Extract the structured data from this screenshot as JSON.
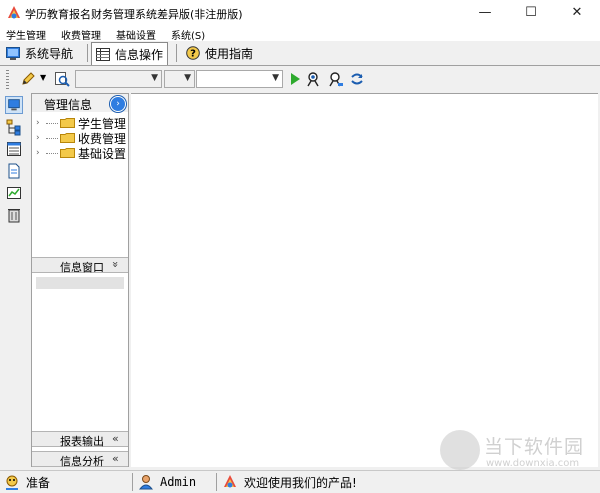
{
  "window": {
    "title": "学历教育报名财务管理系统差异版(非注册版)",
    "controls": {
      "minimize": "—",
      "maximize": "☐",
      "close": "✕"
    }
  },
  "menubar": {
    "items": [
      {
        "label": "学生管理"
      },
      {
        "label": "收费管理"
      },
      {
        "label": "基础设置"
      },
      {
        "label": "系统(S)"
      }
    ]
  },
  "tabs": [
    {
      "label": "系统导航",
      "icon": "monitor-icon"
    },
    {
      "label": "信息操作",
      "icon": "table-icon",
      "active": true
    },
    {
      "label": "使用指南",
      "icon": "help-icon"
    }
  ],
  "toolbar": {
    "combo1": "",
    "combo2": "",
    "combo3": "",
    "icons": [
      "pencil-icon",
      "dropdown-icon",
      "preview-icon",
      "play-icon",
      "search-user-icon",
      "find-icon",
      "refresh-icon"
    ]
  },
  "left_strip": [
    "monitor-icon",
    "tree-icon",
    "list-icon",
    "document-icon",
    "chart-icon",
    "trash-icon"
  ],
  "management_panel": {
    "title": "管理信息",
    "tree": [
      {
        "label": "学生管理"
      },
      {
        "label": "收费管理"
      },
      {
        "label": "基础设置"
      }
    ],
    "info_window": {
      "title": "信息窗口",
      "arrow": "»"
    },
    "report_output": {
      "title": "报表输出",
      "arrow": "«"
    },
    "info_analysis": {
      "title": "信息分析",
      "arrow": "«"
    }
  },
  "statusbar": {
    "ready": "准备",
    "user": "Admin",
    "message": "欢迎使用我们的产品!"
  },
  "watermark": {
    "text": "当下软件园",
    "url": "www.downxia.com"
  },
  "colors": {
    "accent_blue": "#2f7de1",
    "play_green": "#2eaa2e",
    "folder_yellow": "#f3c94a"
  }
}
